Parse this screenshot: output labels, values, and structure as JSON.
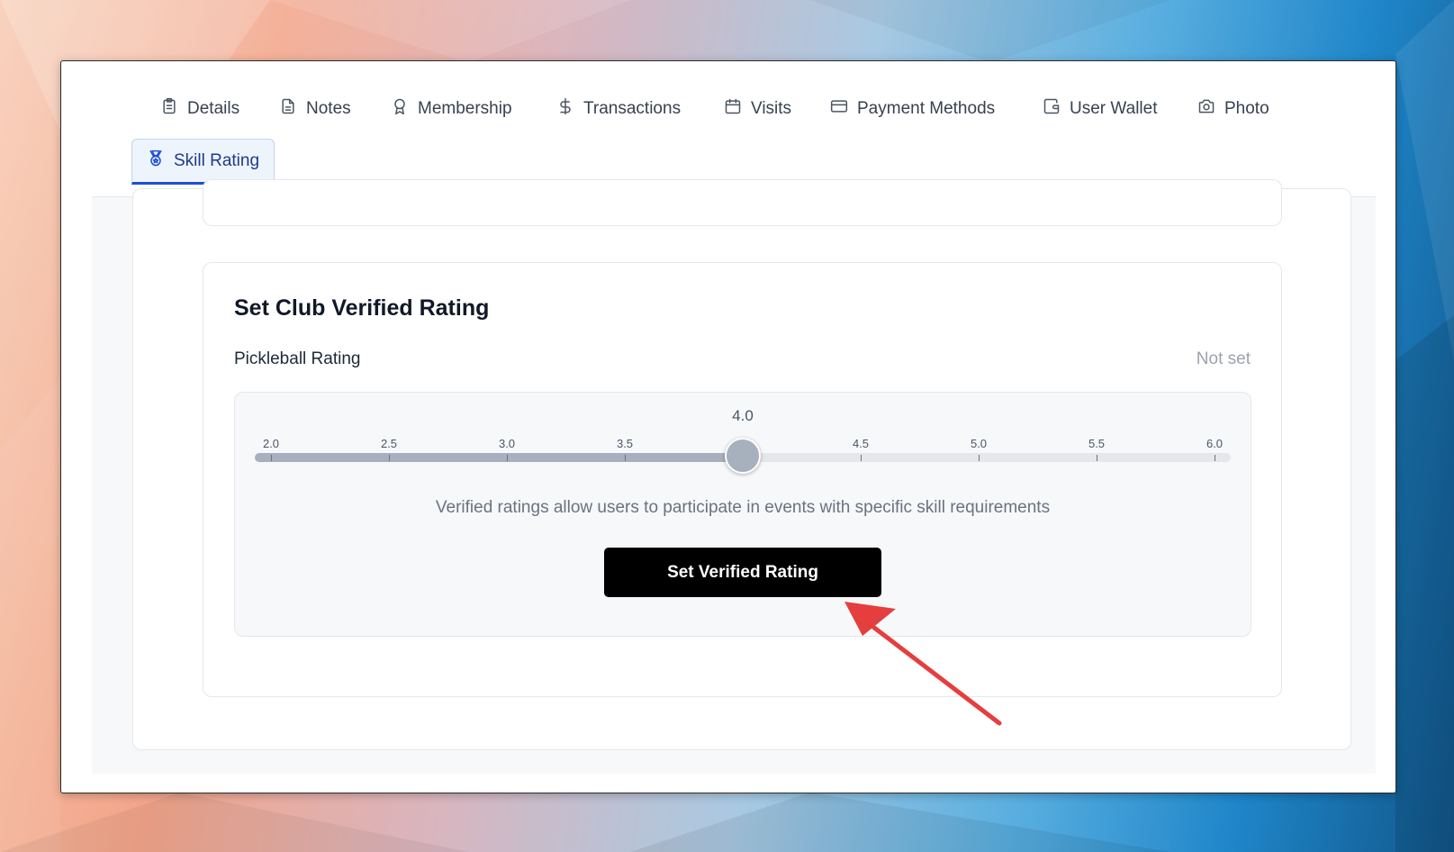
{
  "tabs": [
    {
      "label": "Details",
      "icon": "clipboard-icon"
    },
    {
      "label": "Notes",
      "icon": "document-icon"
    },
    {
      "label": "Membership",
      "icon": "award-icon"
    },
    {
      "label": "Transactions",
      "icon": "dollar-icon"
    },
    {
      "label": "Visits",
      "icon": "calendar-icon"
    },
    {
      "label": "Payment Methods",
      "icon": "credit-card-icon"
    },
    {
      "label": "User Wallet",
      "icon": "wallet-icon"
    },
    {
      "label": "Photo",
      "icon": "camera-icon"
    },
    {
      "label": "Skill Rating",
      "icon": "medal-icon",
      "active": true
    }
  ],
  "rating_card": {
    "title": "Set Club Verified Rating",
    "field_label": "Pickleball Rating",
    "status": "Not set",
    "slider": {
      "current_value": "4.0",
      "value": 4.0,
      "min": 2.0,
      "max": 6.0,
      "ticks": [
        "2.0",
        "2.5",
        "3.0",
        "3.5",
        "4.0",
        "4.5",
        "5.0",
        "5.5",
        "6.0"
      ]
    },
    "help_text": "Verified ratings allow users to participate in events with specific skill requirements",
    "button_label": "Set Verified Rating"
  },
  "colors": {
    "accent_blue": "#1d4ed8",
    "slider_fill": "#a7b0bd",
    "button_bg": "#000000",
    "annotation_arrow": "#e53e3e"
  }
}
